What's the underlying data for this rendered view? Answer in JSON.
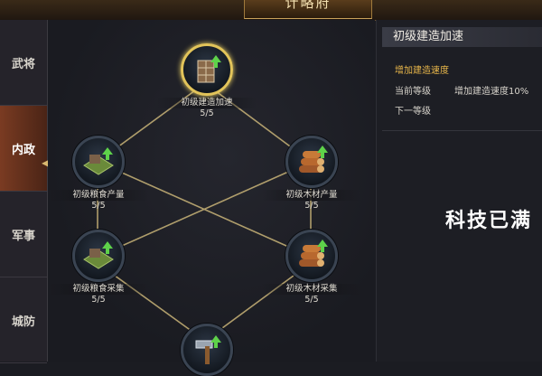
{
  "header": {
    "title": "计略府"
  },
  "sidebar": {
    "tabs": [
      {
        "label": "武将",
        "active": false
      },
      {
        "label": "内政",
        "active": true
      },
      {
        "label": "军事",
        "active": false
      },
      {
        "label": "城防",
        "active": false
      }
    ]
  },
  "tree": {
    "nodes": [
      {
        "label": "初级建造加速",
        "level": "5/5",
        "icon": "construction-scaffold-icon",
        "selected": true
      },
      {
        "label": "初级粮食产量",
        "level": "5/5",
        "icon": "grain-field-icon"
      },
      {
        "label": "初级木材产量",
        "level": "5/5",
        "icon": "lumber-logs-icon"
      },
      {
        "label": "初级粮食采集",
        "level": "5/5",
        "icon": "grain-field-icon"
      },
      {
        "label": "初级木材采集",
        "level": "5/5",
        "icon": "lumber-logs-icon"
      },
      {
        "label": "",
        "level": "",
        "icon": "hammer-icon"
      }
    ]
  },
  "detail": {
    "title": "初级建造加速",
    "subtitle": "增加建造速度",
    "current_label": "当前等级",
    "current_value": "增加建造速度10%",
    "next_label": "下一等级",
    "status": "科技已满"
  },
  "colors": {
    "accent_gold": "#e2c45a",
    "subtitle_orange": "#e8b64a",
    "active_tab": "#7a3b22"
  }
}
